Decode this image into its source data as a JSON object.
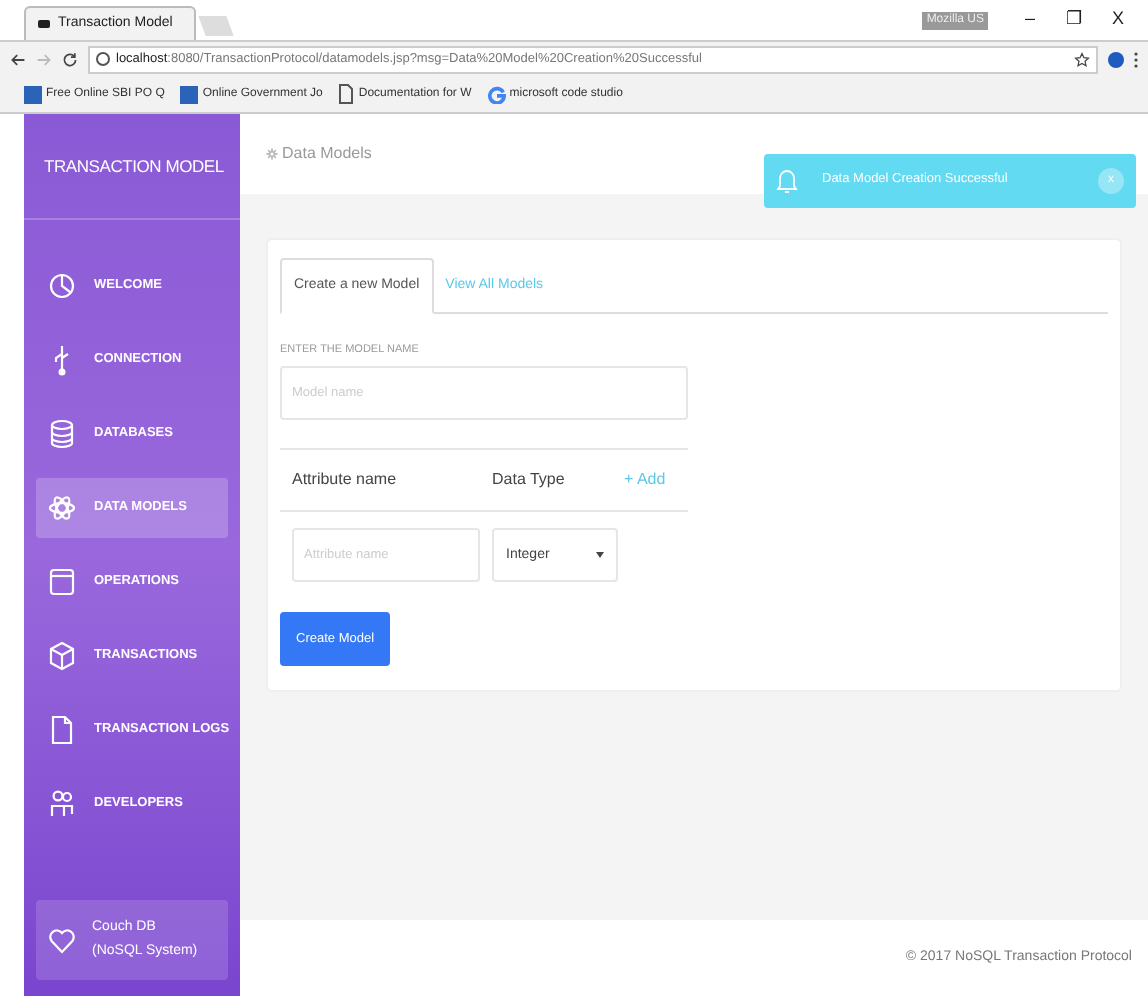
{
  "browser": {
    "tabs": [
      {
        "title": "Transaction Model",
        "selected": true
      }
    ],
    "profile": "Mozilla US",
    "url_host": "localhost",
    "url_rest": ":8080/TransactionProtocol/datamodels.jsp?msg=Data%20Model%20Creation%20Successful",
    "window_controls": [
      "–",
      "❐",
      "X"
    ],
    "bookmarks": [
      {
        "kind": "flag",
        "label": "Free Online SBI PO Q"
      },
      {
        "kind": "flag",
        "label": "Online Government Jo"
      },
      {
        "kind": "doc",
        "label": "Documentation for W"
      },
      {
        "kind": "google",
        "label": "microsoft code studio"
      }
    ]
  },
  "sidebar": {
    "brand": "TRANSACTION MODEL",
    "items": [
      {
        "label": "WELCOME",
        "selected": false
      },
      {
        "label": "CONNECTION",
        "selected": false
      },
      {
        "label": "DATABASES",
        "selected": false
      },
      {
        "label": "DATA MODELS",
        "selected": true
      },
      {
        "label": "OPERATIONS",
        "selected": false
      },
      {
        "label": "TRANSACTIONS",
        "selected": false
      },
      {
        "label": "TRANSACTION LOGS",
        "selected": false
      },
      {
        "label": "DEVELOPERS",
        "selected": false
      }
    ],
    "footer": [
      "Couch DB",
      "(NoSQL System)"
    ]
  },
  "header": {
    "title": "Data Models"
  },
  "toast": {
    "message": "Data Model Creation Successful",
    "close": "x"
  },
  "card": {
    "tabs": [
      {
        "label": "Create a new Model",
        "selected": true
      },
      {
        "label": "View All Models",
        "selected": false
      }
    ],
    "name_label": "ENTER THE MODEL NAME",
    "name_field": {
      "placeholder": "Model name"
    },
    "attributes_header": {
      "name": "Attribute name",
      "type": "Data Type",
      "add": "+ Add"
    },
    "attribute_rows": [
      {
        "placeholder": "Attribute name",
        "type": "Integer"
      }
    ],
    "submit": "Create Model"
  },
  "footer": "© 2017 NoSQL Transaction Protocol"
}
